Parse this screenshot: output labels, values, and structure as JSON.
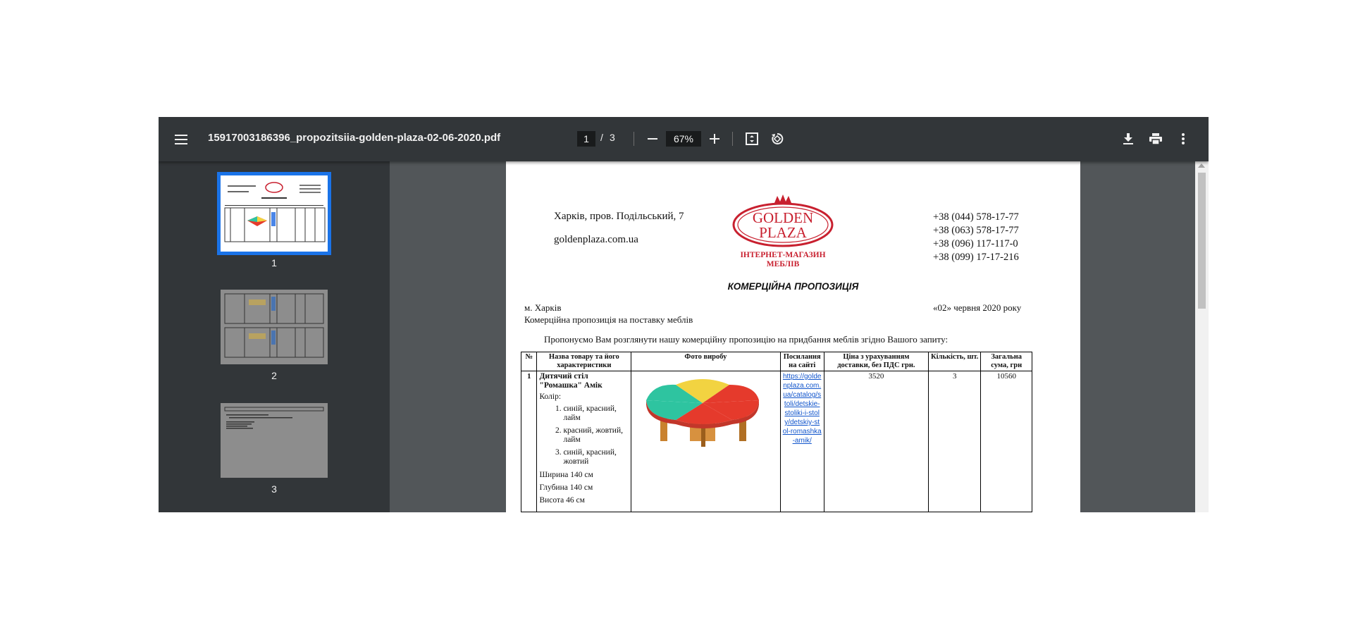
{
  "toolbar": {
    "title": "15917003186396_propozitsiia-golden-plaza-02-06-2020.pdf",
    "current_page": "1",
    "page_separator": "/",
    "total_pages": "3",
    "zoom": "67%",
    "icons": {
      "menu": "menu-icon",
      "zoom_out": "minus-icon",
      "zoom_in": "plus-icon",
      "fit": "fit-page-icon",
      "rotate": "rotate-icon",
      "download": "download-icon",
      "print": "print-icon",
      "more": "more-vert-icon"
    }
  },
  "sidebar": {
    "thumbnails": [
      {
        "label": "1"
      },
      {
        "label": "2"
      },
      {
        "label": "3"
      }
    ]
  },
  "document": {
    "address": "Харків, пров. Подільський, 7",
    "website": "goldenplaza.com.ua",
    "logo": {
      "line1": "GOLDEN",
      "line2": "PLAZA",
      "sub1": "ІНТЕРНЕТ-МАГАЗИН",
      "sub2": "МЕБЛІВ"
    },
    "phones": [
      "+38 (044) 578-17-77",
      "+38 (063) 578-17-77",
      "+38 (096) 117-117-0",
      "+38 (099) 17-17-216"
    ],
    "heading": "КОМЕРЦІЙНА ПРОПОЗИЦІЯ",
    "city": "м. Харків",
    "date": "«02» червня  2020 року",
    "subject": "Комерційна пропозиція на поставку меблів",
    "intro": "Пропонуємо Вам розглянути нашу комерційну пропозицію на придбання меблів згідно Вашого запиту:",
    "table": {
      "headers": {
        "num": "№",
        "name": "Назва товару та його характеристики",
        "photo": "Фото виробу",
        "link": "Посилання на сайті",
        "price": "Ціна з урахуванням доставки, без ПДС грн.",
        "qty": "Кількість, шт.",
        "total": "Загальна сума, грн"
      },
      "rows": [
        {
          "num": "1",
          "name": "Дитячий стіл \"Ромашка\" Амік",
          "color_label": "Колір:",
          "colors": [
            "синій, красний, лайм",
            " красний, жовтий, лайм",
            "синій, красний, жовтий"
          ],
          "width": "Ширина 140 см",
          "depth": "Глубина 140 см",
          "height": "Висота 46 см",
          "link": "https://goldenplaza.com.ua/catalog/stoli/detskie-stoliki-i-stoly/detskiy-stol-romashka-amik/",
          "price": "3520",
          "qty": "3",
          "total": "10560"
        }
      ]
    }
  },
  "colors": {
    "toolbar_bg": "#323639",
    "viewer_bg": "#525659",
    "accent": "#1a73e8",
    "logo_red": "#c8202f"
  }
}
